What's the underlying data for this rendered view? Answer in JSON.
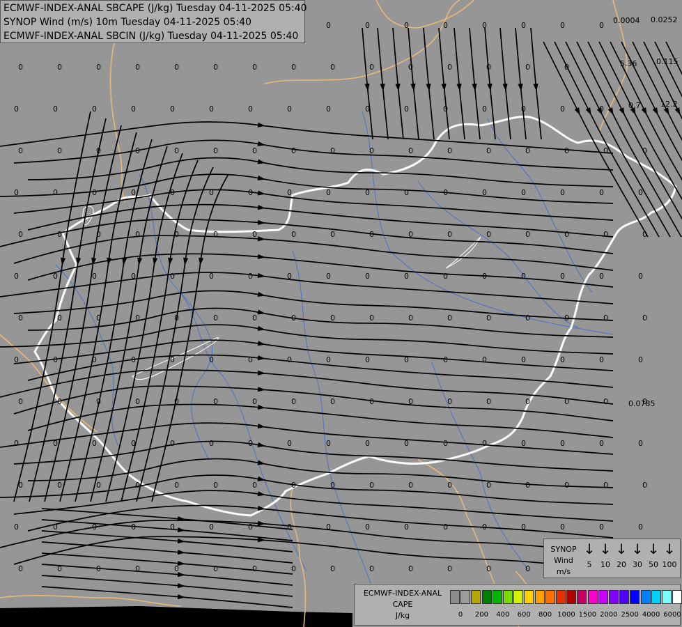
{
  "title_lines": [
    "ECMWF-INDEX-ANAL SBCAPE (J/kg) Tuesday 04-11-2025 05:40",
    "SYNOP Wind (m/s) 10m Tuesday 04-11-2025 05:40",
    "ECMWF-INDEX-ANAL SBCIN (J/kg) Tuesday 04-11-2025 05:40"
  ],
  "cape_values": [
    "0.0004",
    "0.0252",
    "5.36",
    "0.115",
    "0.7",
    "12.2",
    "0.0785"
  ],
  "synop_legend": {
    "title": [
      "SYNOP",
      "Wind",
      "m/s"
    ],
    "speeds": [
      "5",
      "10",
      "20",
      "30",
      "50",
      "100"
    ]
  },
  "cape_legend": {
    "title": [
      "ECMWF-INDEX-ANAL",
      "CAPE",
      "J/kg"
    ],
    "colors": [
      "#8c8c8c",
      "#9c9c9c",
      "#b4a800",
      "#008000",
      "#00b400",
      "#78dc00",
      "#d2f000",
      "#ffd200",
      "#ffa000",
      "#ff6e00",
      "#e63200",
      "#b40000",
      "#c80064",
      "#ff00c8",
      "#c800ff",
      "#8200ff",
      "#5000ff",
      "#0000ff",
      "#0082ff",
      "#00d2ff",
      "#78ffff",
      "#ffffff"
    ],
    "ticks": [
      "0",
      "200",
      "400",
      "600",
      "800",
      "1000",
      "1500",
      "2000",
      "2500",
      "4000",
      "6000"
    ]
  },
  "colors": {
    "background": "#969696",
    "border_white": "#ffffff",
    "border_tan": "#e8b878",
    "river": "#4a72c8",
    "streamline": "#000000"
  }
}
